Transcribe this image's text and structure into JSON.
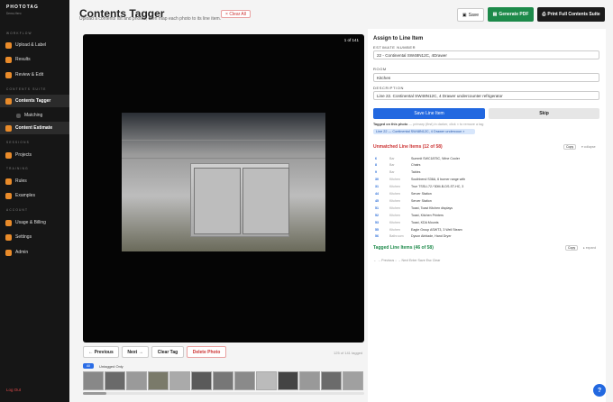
{
  "brand": {
    "name": "PHOTOTAG",
    "sub": "Demo-Hero"
  },
  "sidebar": {
    "workflow_label": "WORKFLOW",
    "upload": "Upload & Label",
    "results": "Results",
    "review": "Review & Edit",
    "contents_label": "CONTENTS SUITE",
    "tagger": "Contents Tagger",
    "matching": "Matching",
    "estimate": "Content Estimate",
    "sessions_label": "SESSIONS",
    "projects": "Projects",
    "training_label": "TRAINING",
    "rules": "Rules",
    "examples": "Examples",
    "account_label": "ACCOUNT",
    "billing": "Usage & Billing",
    "settings": "Settings",
    "admin": "Admin",
    "logout": "Log Out"
  },
  "header": {
    "title": "Contents Tagger",
    "subtitle": "Upload a contents list and photos, then map each photo to its line item.",
    "clear_all": "× Clear All",
    "save": "Save",
    "generate_pdf": "Generate PDF",
    "print_suite": "Print Full Contents Suite"
  },
  "viewer": {
    "counter": "1 of 141"
  },
  "controls": {
    "previous": "← Previous",
    "next": "Next →",
    "clear_tag": "Clear Tag",
    "delete_photo": "Delete Photo",
    "tagged_count": "125 of 141 tagged"
  },
  "filter": {
    "all": "All",
    "untagged": "Untagged Only"
  },
  "panel": {
    "title": "Assign to Line Item",
    "estimate_label": "ESTIMATE NUMBER",
    "estimate_value": "22 - Continental SW48N12C, 4Drawer",
    "room_label": "ROOM",
    "room_value": "Kitchen",
    "description_label": "DESCRIPTION",
    "description_value": "Line 22. Continental SW48N12C, 4 Drawer undercounter refrigerator",
    "save_line": "Save Line Item",
    "skip": "Skip",
    "tagged_on": "Tagged on this photo",
    "tagged_hint": "— primary (first) in darker, click × to remove a tag",
    "chip": "Line 22 — Continental SW48N12C, 4 Drawer undercoun ×"
  },
  "unmatched": {
    "title": "Unmatched Line Items (12 of 58)",
    "copy": "Copy",
    "collapse": "▾ collapse",
    "rows": [
      {
        "num": "6",
        "room": "Bar",
        "desc": "Summit SWC1875C, Wine Cooler"
      },
      {
        "num": "8",
        "room": "Bar",
        "desc": "Chairs"
      },
      {
        "num": "9",
        "room": "Bar",
        "desc": "Tables"
      },
      {
        "num": "30",
        "room": "Kitchen",
        "desc": "Southbend S36A, 6 burner range with"
      },
      {
        "num": "31",
        "room": "Kitchen",
        "desc": "True TSSU-72-*30M-B-DS-ST-HC, 3"
      },
      {
        "num": "44",
        "room": "Kitchen",
        "desc": "Server Station"
      },
      {
        "num": "45",
        "room": "Kitchen",
        "desc": "Server Station"
      },
      {
        "num": "51",
        "room": "Kitchen",
        "desc": "Toast, Toast Kitchen displays"
      },
      {
        "num": "52",
        "room": "Kitchen",
        "desc": "Toast, Kitchen Printers"
      },
      {
        "num": "53",
        "room": "Kitchen",
        "desc": "Toast, KDA Mounts"
      },
      {
        "num": "55",
        "room": "Kitchen",
        "desc": "Eagle Group ASWT3, 3 Well Steam"
      },
      {
        "num": "56",
        "room": "Bathroom",
        "desc": "Dyson Airblade, Hand Dryer"
      }
    ]
  },
  "tagged_section": {
    "title": "Tagged Line Items (46 of 58)",
    "copy": "Copy",
    "expand": "▸ expand"
  },
  "keys": "← → Previous   ↓ → Next   Enter Save   Esc Clear",
  "help": "?",
  "colors": {
    "accent": "#2268e0",
    "green": "#1d8a4a",
    "orange": "#e98b2a",
    "danger": "#c33"
  }
}
